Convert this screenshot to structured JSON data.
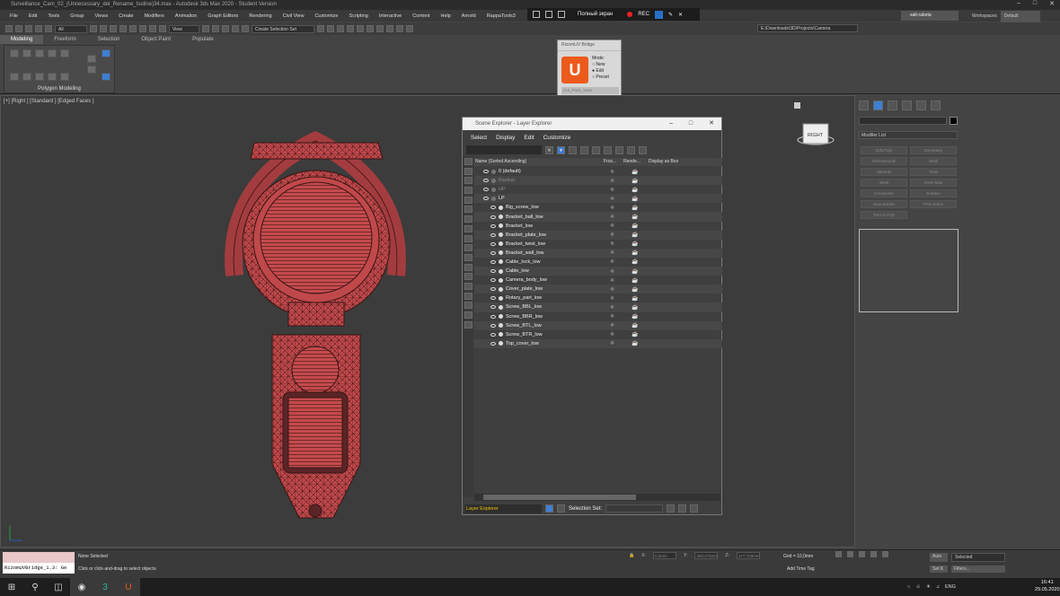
{
  "window": {
    "title": "Surveillance_Cam_02_(Unnecessary_del_Rename_Isoline)34.max - Autodesk 3ds Max 2020 - Student Version"
  },
  "menu": [
    "File",
    "Edit",
    "Tools",
    "Group",
    "Views",
    "Create",
    "Modifiers",
    "Animation",
    "Graph Editors",
    "Rendering",
    "Civil View",
    "Customize",
    "Scripting",
    "Interactive",
    "Content",
    "Help",
    "Arnold",
    "RappaTools3"
  ],
  "recorder": {
    "fullscreen": "Полный экран",
    "rec": "REC"
  },
  "user": {
    "name": "salt-rabota",
    "workspaces_label": "Workspaces:",
    "workspace": "Default"
  },
  "toolbar": {
    "filter": "All",
    "view": "View",
    "selection_set": "Create Selection Set",
    "path": "E:\\Downloads\\3D\\Projects\\Camera"
  },
  "ribbon": {
    "tabs": [
      "Modeling",
      "Freeform",
      "Selection",
      "Object Paint",
      "Populate"
    ],
    "panel": "Polygon Modeling"
  },
  "rizom": {
    "title": "RizomUV Bridge",
    "mode_label": "Mode:",
    "modes": [
      "New",
      "Edit",
      "Preset"
    ],
    "preset": "Cut_Pack_Save"
  },
  "viewport": {
    "label": "[+] [Right ] [Standard ] [Edged Faces ]",
    "cube": "RIGHT"
  },
  "scene_explorer": {
    "title": "Scene Explorer - Layer Explorer",
    "menu": [
      "Select",
      "Display",
      "Edit",
      "Customize"
    ],
    "columns": [
      "Name (Sorted Ascending)",
      "Froz...",
      "Rende...",
      "Display as Box"
    ],
    "rows": [
      {
        "name": "0 (default)",
        "dim": false,
        "layer": true
      },
      {
        "name": "Backup",
        "dim": true,
        "layer": true
      },
      {
        "name": "HP",
        "dim": true,
        "layer": true
      },
      {
        "name": "LP",
        "dim": false,
        "layer": true
      },
      {
        "name": "Big_screw_low",
        "dim": false,
        "layer": false
      },
      {
        "name": "Bracket_ball_low",
        "dim": false,
        "layer": false
      },
      {
        "name": "Bracket_low",
        "dim": false,
        "layer": false
      },
      {
        "name": "Bracket_plate_low",
        "dim": false,
        "layer": false
      },
      {
        "name": "Bracket_twist_low",
        "dim": false,
        "layer": false
      },
      {
        "name": "Bracket_wall_low",
        "dim": false,
        "layer": false
      },
      {
        "name": "Cable_lock_low",
        "dim": false,
        "layer": false
      },
      {
        "name": "Cable_low",
        "dim": false,
        "layer": false
      },
      {
        "name": "Camera_body_low",
        "dim": false,
        "layer": false
      },
      {
        "name": "Cover_plate_low",
        "dim": false,
        "layer": false
      },
      {
        "name": "Rotary_part_low",
        "dim": false,
        "layer": false
      },
      {
        "name": "Screw_BBL_low",
        "dim": false,
        "layer": false
      },
      {
        "name": "Screw_BBR_low",
        "dim": false,
        "layer": false
      },
      {
        "name": "Screw_BTL_low",
        "dim": false,
        "layer": false
      },
      {
        "name": "Screw_BTR_low",
        "dim": false,
        "layer": false
      },
      {
        "name": "Top_cover_low",
        "dim": false,
        "layer": false
      }
    ],
    "footer_explorer": "Layer Explorer",
    "selection_set_label": "Selection Set:"
  },
  "command_panel": {
    "modifier_list": "Modifier List",
    "buttons": [
      "Edit Poly",
      "Symmetry",
      "TurboSmooth",
      "Shell",
      "Spherify",
      "Twist",
      "Shell",
      "UVW Map",
      "CreaseSet",
      "Surface",
      "OpenSubdiv",
      "FFD 3x3x3",
      "Turn to Poly"
    ]
  },
  "status": {
    "maxscript": "RizomUVBridge_1.3: Ge",
    "none_selected": "None Selected",
    "hint": "Click or click-and-drag to select objects",
    "x_label": "X:",
    "x": "0,0mm",
    "y_label": "Y:",
    "y": "400,473mm",
    "z_label": "Z:",
    "z": "177,703mm",
    "grid": "Grid = 10,0mm",
    "add_time_tag": "Add Time Tag",
    "frame": "0",
    "auto": "Auto",
    "set_key": "Set K.",
    "selected": "Selected",
    "filters": "Filters..."
  },
  "taskbar": {
    "lang": "ENG",
    "time": "16:41",
    "date": "29.05.2020"
  },
  "colors": {
    "model": "#c0484a",
    "accent": "#3c7fd4",
    "highlight": "#e8c000"
  }
}
